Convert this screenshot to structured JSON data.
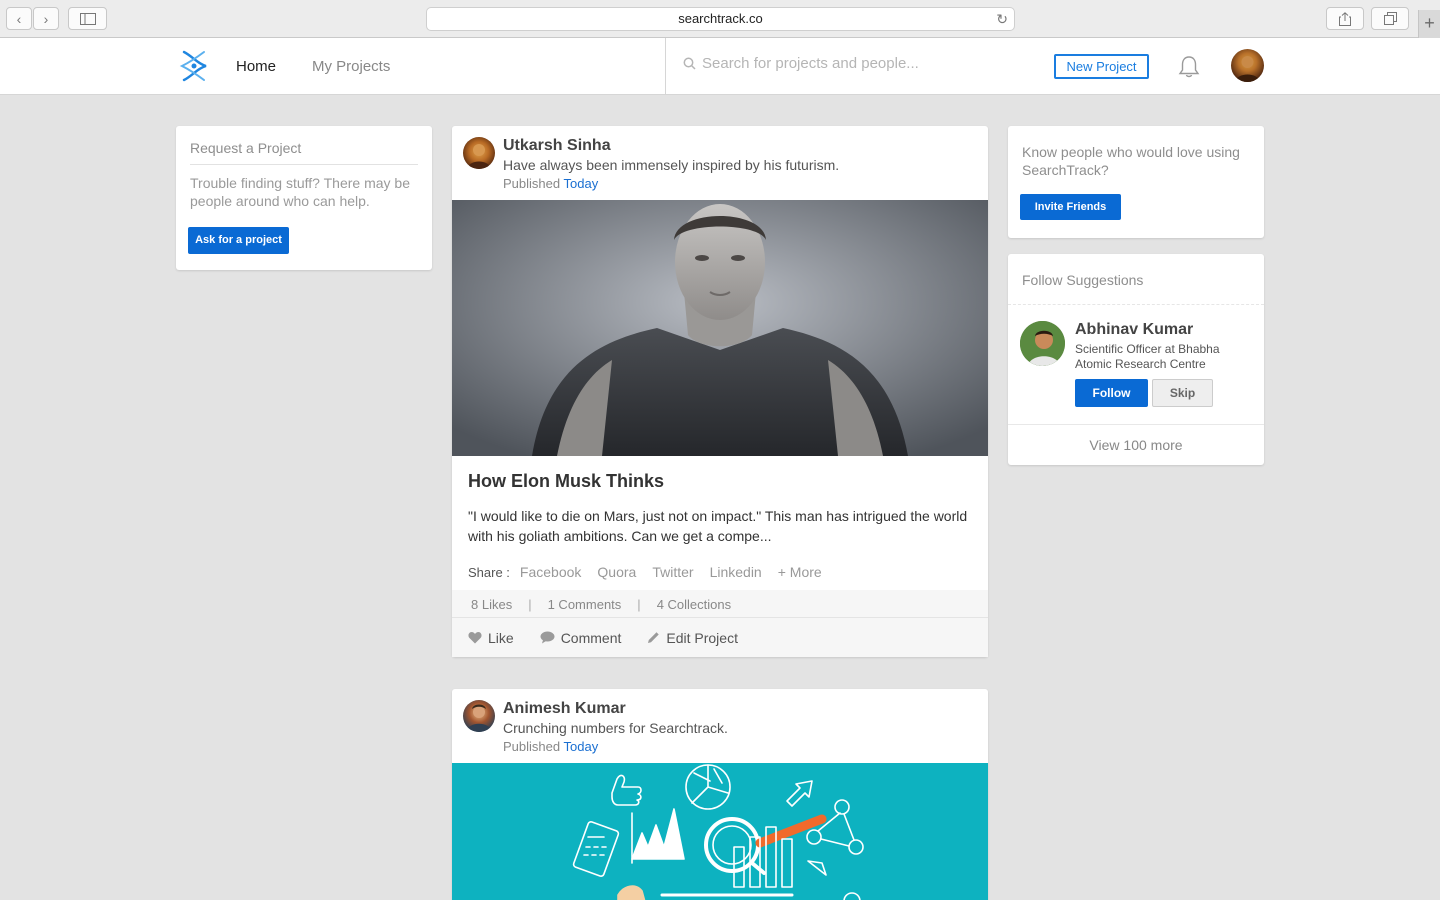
{
  "browser": {
    "url": "searchtrack.co"
  },
  "header": {
    "nav": [
      {
        "label": "Home"
      },
      {
        "label": "My Projects"
      }
    ],
    "search_placeholder": "Search for projects and people...",
    "new_project_label": "New Project"
  },
  "left": {
    "title": "Request a Project",
    "text": "Trouble finding stuff? There may be people around who can help.",
    "button_label": "Ask for a project"
  },
  "posts": [
    {
      "author": "Utkarsh Sinha",
      "subtitle": "Have always been immensely inspired by his futurism.",
      "published_label": "Published",
      "published_when": "Today",
      "title": "How Elon Musk Thinks",
      "excerpt": "\"I would like to die on Mars, just not on impact.\" This man has intrigued the world with his goliath ambitions. Can we get a compe...",
      "share_label": "Share :",
      "share_links": [
        "Facebook",
        "Quora",
        "Twitter",
        "Linkedin",
        "+ More"
      ],
      "stats": {
        "likes": "8 Likes",
        "comments": "1 Comments",
        "collections": "4 Collections",
        "separator": "|"
      },
      "actions": {
        "like": "Like",
        "comment": "Comment",
        "edit": "Edit Project"
      }
    },
    {
      "author": "Animesh Kumar",
      "subtitle": "Crunching numbers for Searchtrack.",
      "published_label": "Published",
      "published_when": "Today"
    }
  ],
  "right": {
    "invite_text": "Know people who would love using SearchTrack?",
    "invite_button": "Invite Friends",
    "follow_title": "Follow Suggestions",
    "suggestion": {
      "name": "Abhinav Kumar",
      "role": "Scientific Officer at Bhabha Atomic Research Centre",
      "follow_label": "Follow",
      "skip_label": "Skip"
    },
    "view_more": "View 100 more"
  },
  "colors": {
    "accent": "#0a6ad4",
    "background": "#e3e3e3",
    "link": "#1a6fd1"
  },
  "icons": [
    "back-icon",
    "forward-icon",
    "sidebar-icon",
    "reload-icon",
    "share-icon",
    "tabs-icon",
    "plus-icon",
    "logo-icon",
    "search-icon",
    "bell-icon",
    "heart-icon",
    "comment-icon",
    "pencil-icon"
  ]
}
